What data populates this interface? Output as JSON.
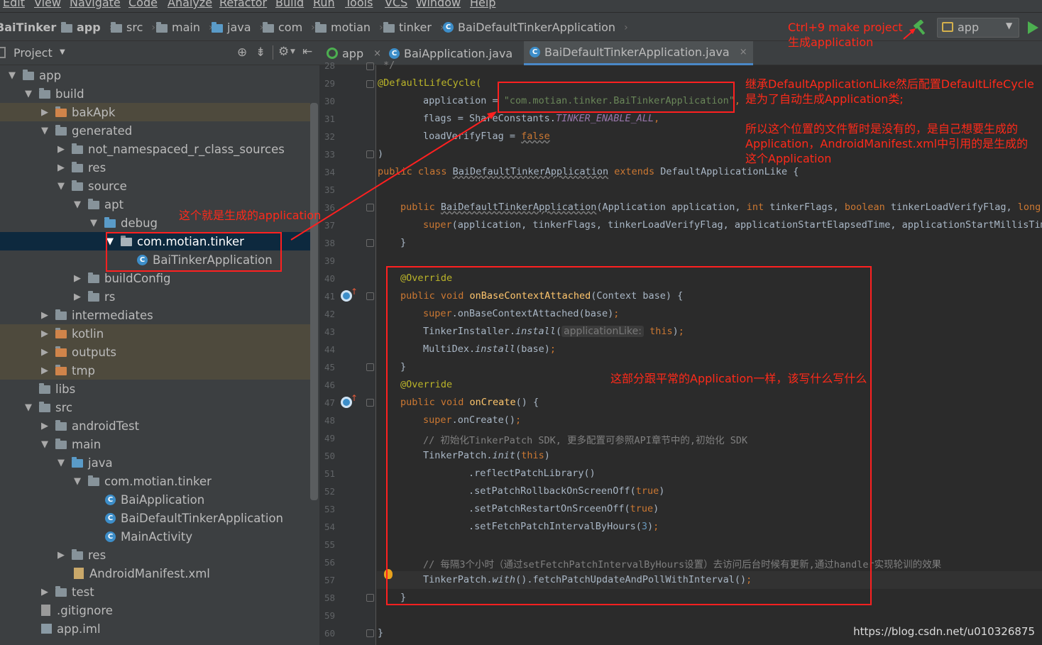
{
  "menu": [
    "Edit",
    "View",
    "Navigate",
    "Code",
    "Analyze",
    "Refactor",
    "Build",
    "Run",
    "Tools",
    "VCS",
    "Window",
    "Help"
  ],
  "breadcrumb": [
    "BaiTinker",
    "app",
    "src",
    "main",
    "java",
    "com",
    "motian",
    "tinker",
    "BaiDefaultTinkerApplication"
  ],
  "run_config": {
    "label": "app"
  },
  "project_panel": {
    "title": "Project"
  },
  "tree": [
    {
      "label": "app",
      "icon": "module-folder",
      "expanded": true
    },
    {
      "label": "build",
      "icon": "folder",
      "expanded": true
    },
    {
      "label": "bakApk",
      "icon": "folder-orange",
      "expanded": false
    },
    {
      "label": "generated",
      "icon": "folder",
      "expanded": true
    },
    {
      "label": "not_namespaced_r_class_sources",
      "icon": "folder",
      "expanded": false
    },
    {
      "label": "res",
      "icon": "folder",
      "expanded": false
    },
    {
      "label": "source",
      "icon": "folder",
      "expanded": true
    },
    {
      "label": "apt",
      "icon": "folder",
      "expanded": true
    },
    {
      "label": "debug",
      "icon": "source-folder",
      "expanded": true
    },
    {
      "label": "com.motian.tinker",
      "icon": "package",
      "expanded": true
    },
    {
      "label": "BaiTinkerApplication",
      "icon": "class",
      "expanded": null
    },
    {
      "label": "buildConfig",
      "icon": "folder",
      "expanded": false
    },
    {
      "label": "rs",
      "icon": "folder",
      "expanded": false
    },
    {
      "label": "intermediates",
      "icon": "folder",
      "expanded": false
    },
    {
      "label": "kotlin",
      "icon": "folder-orange",
      "expanded": false
    },
    {
      "label": "outputs",
      "icon": "folder-orange",
      "expanded": false
    },
    {
      "label": "tmp",
      "icon": "folder-orange",
      "expanded": false
    },
    {
      "label": "libs",
      "icon": "folder",
      "expanded": null
    },
    {
      "label": "src",
      "icon": "folder",
      "expanded": true
    },
    {
      "label": "androidTest",
      "icon": "folder",
      "expanded": false
    },
    {
      "label": "main",
      "icon": "folder",
      "expanded": true
    },
    {
      "label": "java",
      "icon": "source-folder",
      "expanded": true
    },
    {
      "label": "com.motian.tinker",
      "icon": "package",
      "expanded": true
    },
    {
      "label": "BaiApplication",
      "icon": "class",
      "expanded": null
    },
    {
      "label": "BaiDefaultTinkerApplication",
      "icon": "class",
      "expanded": null
    },
    {
      "label": "MainActivity",
      "icon": "activity-class",
      "expanded": null
    },
    {
      "label": "res",
      "icon": "res-folder",
      "expanded": false
    },
    {
      "label": "AndroidManifest.xml",
      "icon": "xml-file",
      "expanded": null
    },
    {
      "label": "test",
      "icon": "folder",
      "expanded": false
    },
    {
      "label": ".gitignore",
      "icon": "text-file",
      "expanded": null
    },
    {
      "label": "app.iml",
      "icon": "iml-file",
      "expanded": null
    }
  ],
  "tabs": [
    {
      "label": "app",
      "active": false
    },
    {
      "label": "BaiApplication.java",
      "active": false
    },
    {
      "label": "BaiDefaultTinkerApplication.java",
      "active": true
    }
  ],
  "line_numbers": [
    "28",
    "29",
    "30",
    "31",
    "32",
    "33",
    "34",
    "35",
    "36",
    "37",
    "38",
    "39",
    "40",
    "41",
    "42",
    "43",
    "44",
    "45",
    "46",
    "47",
    "48",
    "49",
    "50",
    "51",
    "52",
    "53",
    "54",
    "55",
    "56",
    "57",
    "58",
    "59",
    "60"
  ],
  "code": {
    "l28": "*/",
    "l29_annotation": "@DefaultLifeCycle(",
    "l30_key": "application = ",
    "l30_value": "\"com.motian.tinker.BaiTinkerApplication\"",
    "l30_end": ",",
    "l31_a": "flags = ShareConstants.",
    "l31_b": "TINKER_ENABLE_ALL",
    "l31_c": ",",
    "l32_a": "loadVerifyFlag = ",
    "l32_b": "false",
    "l33": ")",
    "l34_a": "public class ",
    "l34_b": "BaiDefaultTinkerApplication",
    "l34_c": " extends ",
    "l34_d": "DefaultApplicationLike {",
    "l36_a": "public ",
    "l36_b": "BaiDefaultTinkerApplication",
    "l36_c": "(Application application, ",
    "l36_d": "int ",
    "l36_e": "tinkerFlags, ",
    "l36_f": "boolean ",
    "l36_g": "tinkerLoadVerifyFlag, ",
    "l36_h": "long a",
    "l37_a": "super",
    "l37_b": "(application, tinkerFlags, tinkerLoadVerifyFlag, applicationStartElapsedTime, applicationStartMillisTime",
    "l38": "}",
    "l40": "@Override",
    "l41_a": "public void ",
    "l41_b": "onBaseContextAttached",
    "l41_c": "(Context base) {",
    "l42_a": "super",
    "l42_b": ".onBaseContextAttached(base)",
    "l42_c": ";",
    "l43_a": "TinkerInstaller.",
    "l43_b": "install",
    "l43_c": "(",
    "l43_hint": "applicationLike:",
    "l43_d": " this",
    "l43_e": ")",
    "l43_f": ";",
    "l44_a": "MultiDex.",
    "l44_b": "install",
    "l44_c": "(base)",
    "l44_d": ";",
    "l45": "}",
    "l46": "@Override",
    "l47_a": "public void ",
    "l47_b": "onCreate",
    "l47_c": "() {",
    "l48_a": "super",
    "l48_b": ".onCreate()",
    "l48_c": ";",
    "l49": "// 初始化TinkerPatch SDK, 更多配置可参照API章节中的,初始化 SDK",
    "l50_a": "TinkerPatch.",
    "l50_b": "init",
    "l50_c": "(",
    "l50_d": "this",
    "l50_e": ")",
    "l51": ".reflectPatchLibrary()",
    "l52_a": ".setPatchRollbackOnScreenOff(",
    "l52_b": "true",
    "l52_c": ")",
    "l53_a": ".setPatchRestartOnSrceenOff(",
    "l53_b": "true",
    "l53_c": ")",
    "l54_a": ".setFetchPatchIntervalByHours(",
    "l54_b": "3",
    "l54_c": ")",
    "l54_d": ";",
    "l56": "// 每隔3个小时（通过setFetchPatchIntervalByHours设置）去访问后台时候有更新,通过handler实现轮训的效果",
    "l57_a": "TinkerPatch.",
    "l57_b": "with",
    "l57_c": "().fetchPatchUpdateAndPollWithInterval()",
    "l57_d": ";",
    "l58": "}",
    "l60": "}"
  },
  "annotations": {
    "make_project": [
      "Ctrl+9 make project",
      "生成application"
    ],
    "generated_app": "这个就是生成的application",
    "extends_note": [
      "继承DefaultApplicationLike然后配置DefaultLifeCycle",
      "是为了自动生成Application类;"
    ],
    "file_note": [
      "所以这个位置的文件暂时是没有的，是自己想要生成的",
      "Application，AndroidManifest.xml中引用的是生成的",
      "这个Application"
    ],
    "same_note": "这部分跟平常的Application一样，该写什么写什么"
  },
  "watermark": "https://blog.csdn.net/u010326875",
  "colors": {
    "annotation": "#ff2a1a",
    "keyword": "#cc7832",
    "string": "#6a8759",
    "annotation_code": "#bbb529",
    "method": "#ffc66d"
  }
}
